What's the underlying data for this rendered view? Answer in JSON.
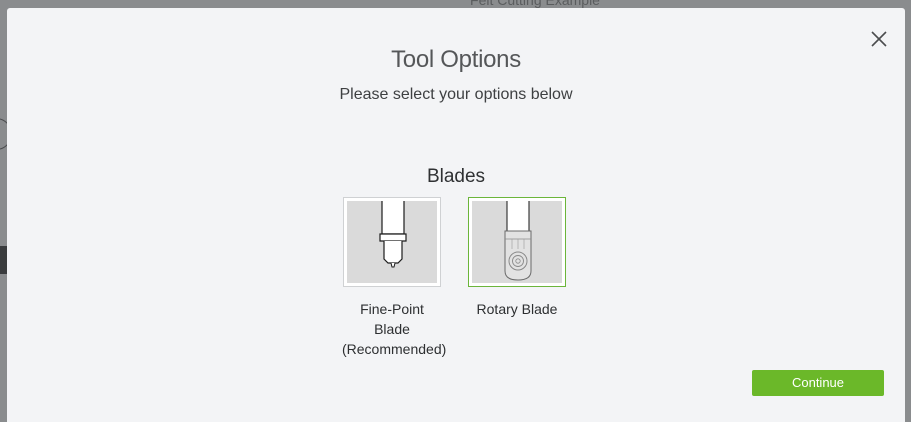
{
  "background": {
    "project_title": "Felt Cutting Example"
  },
  "modal": {
    "title": "Tool Options",
    "subtitle": "Please select your options below",
    "close_icon": "close-icon",
    "section_title": "Blades",
    "blades": [
      {
        "label_line1": "Fine-Point Blade",
        "label_line2": "(Recommended)",
        "selected": false,
        "icon": "fine-point-blade-icon"
      },
      {
        "label_line1": "Rotary Blade",
        "label_line2": "",
        "selected": true,
        "icon": "rotary-blade-icon"
      }
    ],
    "continue_label": "Continue"
  },
  "colors": {
    "accent": "#6bb829",
    "selected_border": "#6bb53a",
    "modal_bg": "#f3f4f6"
  }
}
